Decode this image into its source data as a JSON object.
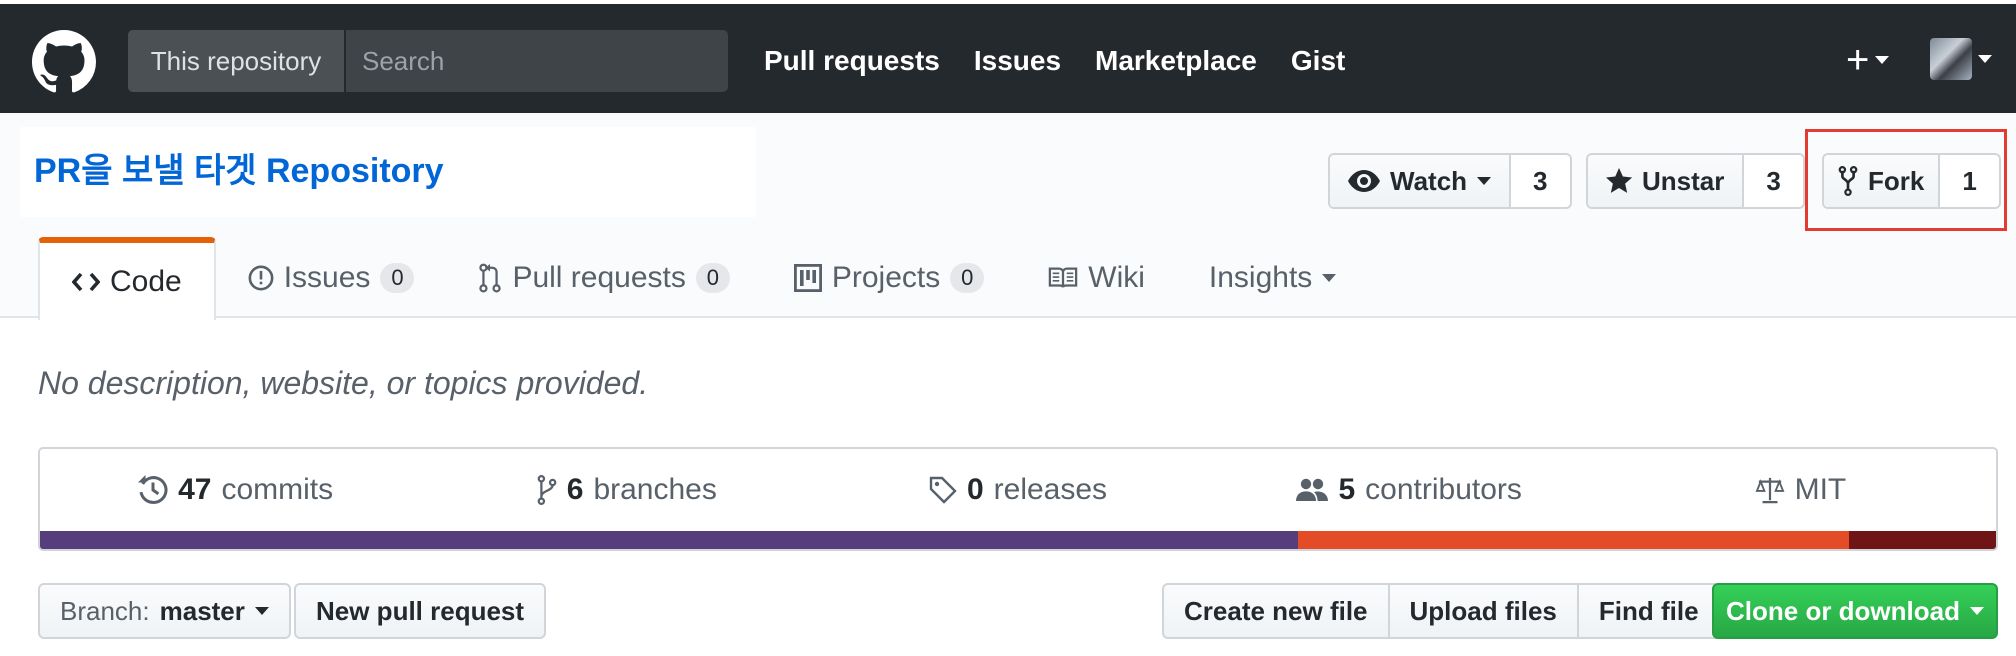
{
  "header": {
    "scope_label": "This repository",
    "search_placeholder": "Search",
    "nav": [
      "Pull requests",
      "Issues",
      "Marketplace",
      "Gist"
    ],
    "plus_icon": "plus-icon",
    "logo_icon": "github-logo-icon"
  },
  "repo": {
    "title": "PR을 보낼 타겟 Repository",
    "watch": {
      "label": "Watch",
      "count": "3",
      "icon": "eye-icon"
    },
    "star": {
      "label": "Unstar",
      "count": "3",
      "icon": "star-icon"
    },
    "fork": {
      "label": "Fork",
      "count": "1",
      "icon": "fork-icon"
    }
  },
  "tabs": [
    {
      "label": "Code",
      "icon": "code-icon",
      "active": true
    },
    {
      "label": "Issues",
      "count": "0",
      "icon": "issue-icon"
    },
    {
      "label": "Pull requests",
      "count": "0",
      "icon": "pull-request-icon"
    },
    {
      "label": "Projects",
      "count": "0",
      "icon": "project-icon"
    },
    {
      "label": "Wiki",
      "icon": "book-icon"
    },
    {
      "label": "Insights",
      "icon": "none"
    }
  ],
  "description": "No description, website, or topics provided.",
  "summary": {
    "commits": {
      "num": "47",
      "label": "commits"
    },
    "branches": {
      "num": "6",
      "label": "branches"
    },
    "releases": {
      "num": "0",
      "label": "releases"
    },
    "contributors": {
      "num": "5",
      "label": "contributors"
    },
    "license": {
      "label": "MIT"
    }
  },
  "languages": [
    {
      "color": "#563d7c",
      "share": 0.643
    },
    {
      "color": "#e34c26",
      "share": 0.282
    },
    {
      "color": "#701516",
      "share": 0.075
    }
  ],
  "toolbar": {
    "branch_prefix": "Branch:",
    "branch_name": "master",
    "new_pr": "New pull request",
    "create_file": "Create new file",
    "upload_files": "Upload files",
    "find_file": "Find file",
    "clone": "Clone or download"
  },
  "colors": {
    "header_bg": "#24292e",
    "link_blue": "#0366d6",
    "tab_accent": "#e36209",
    "clone_green": "#28a745",
    "highlight_red": "#e43b30"
  }
}
